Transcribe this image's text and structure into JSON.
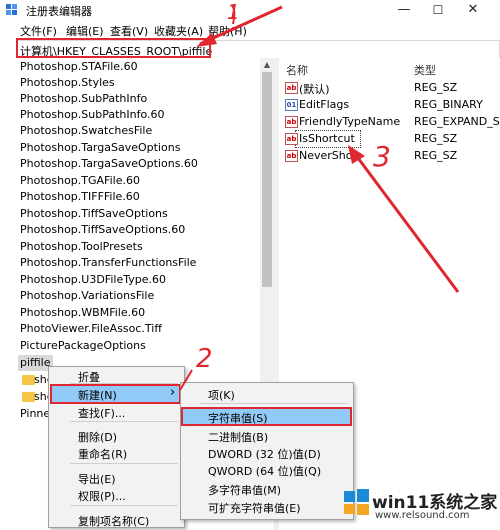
{
  "window": {
    "title": "注册表编辑器",
    "controls": {
      "minimize": "—",
      "maximize": "☐",
      "close": "✕"
    }
  },
  "menubar": [
    "文件(F)",
    "编辑(E)",
    "查看(V)",
    "收藏夹(A)",
    "帮助(H)"
  ],
  "address": "计算机\\HKEY_CLASSES_ROOT\\piffile",
  "tree": {
    "items": [
      "Photoshop.STAFile.60",
      "Photoshop.Styles",
      "Photoshop.SubPathInfo",
      "Photoshop.SubPathInfo.60",
      "Photoshop.SwatchesFile",
      "Photoshop.TargaSaveOptions",
      "Photoshop.TargaSaveOptions.60",
      "Photoshop.TGAFile.60",
      "Photoshop.TIFFFile.60",
      "Photoshop.TiffSaveOptions",
      "Photoshop.TiffSaveOptions.60",
      "Photoshop.ToolPresets",
      "Photoshop.TransferFunctionsFile",
      "Photoshop.U3DFileType.60",
      "Photoshop.VariationsFile",
      "Photoshop.WBMFile.60",
      "PhotoViewer.FileAssoc.Tiff",
      "PicturePackageOptions"
    ],
    "selected": "piffile",
    "children": [
      "she",
      "she"
    ],
    "next": "Pinnec"
  },
  "values": {
    "headers": {
      "name": "名称",
      "type": "类型"
    },
    "rows": [
      {
        "name": "(默认)",
        "type": "REG_SZ"
      },
      {
        "name": "EditFlags",
        "type": "REG_BINARY"
      },
      {
        "name": "FriendlyTypeName",
        "type": "REG_EXPAND_S"
      },
      {
        "name": "IsShortcut",
        "type": "REG_SZ"
      },
      {
        "name": "NeverShow",
        "type": "REG_SZ"
      }
    ],
    "icon_text": "ab"
  },
  "context_menu": {
    "items": [
      "折叠",
      "新建(N)",
      "查找(F)...",
      "删除(D)",
      "重命名(R)",
      "导出(E)",
      "权限(P)...",
      "复制项名称(C)"
    ],
    "arrow": "›"
  },
  "submenu": {
    "items": [
      "项(K)",
      "字符串值(S)",
      "二进制值(B)",
      "DWORD (32 位)值(D)",
      "QWORD (64 位)值(Q)",
      "多字符串值(M)",
      "可扩充字符串值(E)"
    ]
  },
  "annotations": {
    "one": "1",
    "two": "2",
    "three": "3",
    "color": "#e0262f"
  },
  "watermark": {
    "text": "win11系统之家",
    "url": "www.relsound.com"
  }
}
